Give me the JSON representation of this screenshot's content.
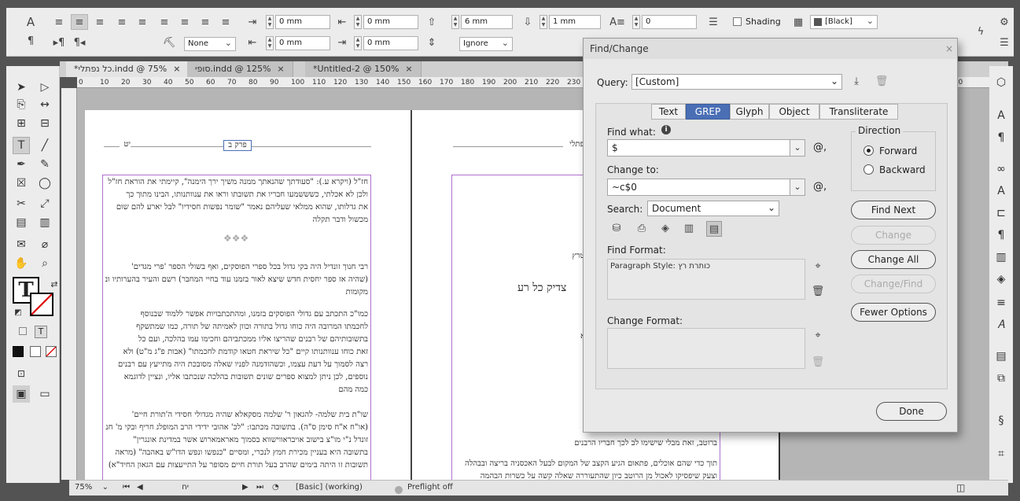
{
  "control_panel": {
    "indent_left": "0 mm",
    "indent_right": "0 mm",
    "indent_first": "0 mm",
    "indent_last": "0 mm",
    "space_before": "6 mm",
    "space_after": "1 mm",
    "drop_cap": "0",
    "align_none": "None",
    "ignore": "Ignore",
    "shading_label": "Shading",
    "shading_color": "[Black]"
  },
  "tabs": [
    {
      "label": "*כל נפתלי.indd @ 75%"
    },
    {
      "label": "סופי.indd @ 125%"
    },
    {
      "label": "*Untitled-2 @ 150%"
    }
  ],
  "ruler_ticks": [
    "0",
    "10",
    "20",
    "30",
    "40",
    "50",
    "60",
    "70",
    "80",
    "90",
    "100",
    "110",
    "120",
    "130",
    "140",
    "150",
    "160",
    "170",
    "180",
    "190",
    "200",
    "210",
    "220",
    "230",
    "240",
    "250",
    "260",
    "270",
    "280",
    "290",
    "300",
    "310",
    "320",
    "330",
    "340",
    "350",
    "360",
    "370",
    "380",
    "390",
    "400",
    "410"
  ],
  "page_left": {
    "header_right": "יט",
    "header_center": "פרק ב",
    "lines": [
      "חז\"ל (ויקרא ע.): \"סעודתך שהנאתך ממנה משיך ירך הימנה\", קיימתי את הוראת חז\"ל",
      "ולכן לא אכלתי, כשששמעו חבריו את תשובתו וראו את ענוותנותו, הבינו מתוך כך",
      "את גדלותו, שהוא ממלאי שעליהם נאמר \"שומר נפשות חסידיו\" לבל יארע להם שום",
      "מכשול ודבר תקלה",
      "רבי חנוך זונדיל היה בקי גדול בכל ספרי הפוסקים, ואף בשולי הספר 'פרי מגדים'",
      "(שהיה אז ספר יחסית חדש שיצא לאור בזמנו עוד בחיי המחבר) רשם והעיר בהערותיו ובמראה",
      "מקומות",
      "כמו\"כ התכתב עם גדולי הפוסקים בזמנו, ומהתכתבויות אפשר ללמוד שבנוסף",
      "לחכמתו המרובה היה כוחו גדול בתורה וכוון לאמיתה של תורה, כמו שמתשקף",
      "בתשובותיהם של רבנים שהריצו אליו ממכתביהם וחכימו עמו בהלכה, ועם כל",
      "זאת כוחו ענוותנותו קיים \"כל שיראת חטאו קודמת לחכמתו\" (אבות פ\"ג מ\"ט) ולא",
      "רצה לסמוך על דעת עצמו, וכשהזדמנה לפניו שאלה מסובכת היה מתייעץ עם רבנים",
      "נוספים, לכן ניתן למצוא ספרים שונים תשובות בהלכה שנכתבו אליו, ונציין לדוגמא",
      "כמה מהם",
      "שו\"ת בית שלמה- להגאון ר' שלמה מסקאלא שהיה מגדולי חסידי ה'תורת חיים'",
      "(או\"ח א\"ח סימן ס\"ה). בתשובה מכתבו: \"לכ' אהובי ידידי הרב המופלג חריף ובקי מ' חנוך",
      "זונדל נ\"י מו\"צ בישוב אויבראווישווא בסמוך מאראמארוש אשר במדינת אונגרין\"",
      "בתשובה היא בעניין מכירת חמץ לנכרי, ומסיים \"כנפשו ונפש הדו\"ש באהבה\" (מראה",
      "תשובות זו היתה בימים שהרב בעל תורת חיים מסופר על התייעצות עם הגאון החיד\"א)"
    ]
  },
  "page_right": {
    "header_right": "נפתלי",
    "heading": "צדיק כל רע",
    "lines": [
      "(ענת תש\"ב) הוציאה הממשלה ההונגרית",
      "ונה את כל היהודים שלא היו רשומים",
      "להוכיח שהם נמצאים בהונגריה ארבעה",
      "ות אבותיהם נולדו בהונגריה והוקמתו",
      "את הרב חנוך זונדיל פולל בתשרייכים יונאוו וטרץ",
      "כתו ופרישותו, וזכה שגן השמים שמרו",
      "ומר חז\"ל (חולין ז.) \"צדיקים אין הקב\"ה מביא",
      "פת רבנים שנסעו למדינת פולין להשתדל",
      "דרך נסיעתם שלקחה מספר ימים, עצרו",
      "עוד אחר התפילה הוגשה לפניהם ארוחת",
      "(מחזה שנעשה מרטוב כבר צלי טבל בה את",
      "מכלו והנו מהמאכל שהיה טעים לחיך, חוץ",
      "הלחם שהגישו לפניהם ונמנע מלהטעים",
      "ברוטב, זאת מבלי שישימו לב לכך חבריו הרבנים",
      "תוך כדי שהם אוכלים, פתאום הגיע הקצב של המקום לבעל האכסניה בריצה ובבהלה",
      "וצעק שיפסיקו לאכול מן הרוטב כיון שהתעוררה שאלה קשה על כשרות הבהמה"
    ]
  },
  "status": {
    "zoom": "75%",
    "page": "יח",
    "style": "[Basic] (working)",
    "preflight": "Preflight off"
  },
  "dialog": {
    "title": "Find/Change",
    "query_label": "Query:",
    "query_value": "[Custom]",
    "tabs": [
      "Text",
      "GREP",
      "Glyph",
      "Object",
      "Transliterate"
    ],
    "selected_tab": "GREP",
    "find_what_label": "Find what:",
    "find_what_value": "$",
    "change_to_label": "Change to:",
    "change_to_value": "~c$0",
    "search_label": "Search:",
    "search_value": "Document",
    "find_format_label": "Find Format:",
    "find_format_value": "Paragraph Style: כותרת רץ",
    "change_format_label": "Change Format:",
    "direction_label": "Direction",
    "forward": "Forward",
    "backward": "Backward",
    "find_next": "Find Next",
    "change": "Change",
    "change_all": "Change All",
    "change_find": "Change/Find",
    "fewer_options": "Fewer Options",
    "done": "Done",
    "at_symbol": "@,"
  }
}
